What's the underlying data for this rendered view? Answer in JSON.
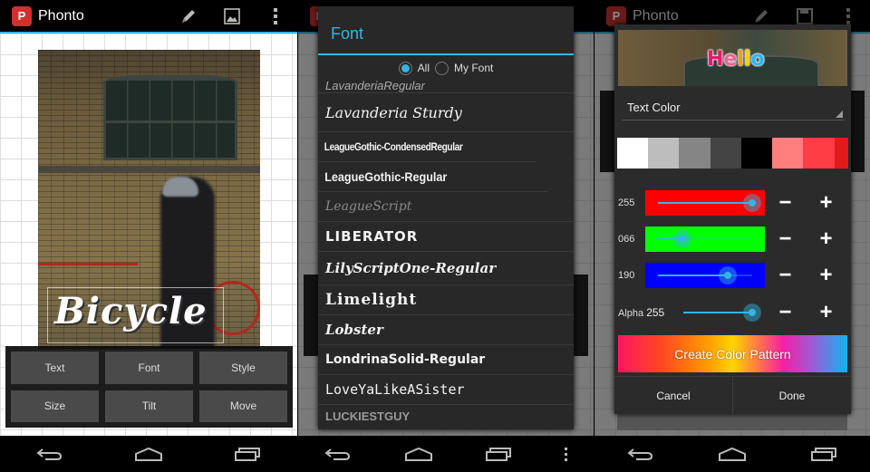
{
  "app": {
    "title": "Phonto",
    "logo_text": "P"
  },
  "screen1": {
    "actionbar_icons": [
      "pencil-icon",
      "image-icon",
      "overflow-menu-icon"
    ],
    "photo_text": "Bicycle",
    "tools": [
      {
        "label": "Text"
      },
      {
        "label": "Font"
      },
      {
        "label": "Style"
      },
      {
        "label": "Size"
      },
      {
        "label": "Tilt"
      },
      {
        "label": "Move"
      }
    ]
  },
  "screen2": {
    "dialog_title": "Font",
    "filter": {
      "options": [
        {
          "label": "All",
          "selected": true
        },
        {
          "label": "My Font",
          "selected": false
        }
      ]
    },
    "fonts": [
      "LavanderiaRegular",
      "Lavanderia Sturdy",
      "LeagueGothic-CondensedRegular",
      "LeagueGothic-Regular",
      "LeagueScript",
      "LIBERATOR",
      "LilyScriptOne-Regular",
      "Limelight",
      "Lobster",
      "LondrinaSolid-Regular",
      "LoveYaLikeASister",
      "LUCKIESTGUY"
    ]
  },
  "screen3": {
    "preview_text": "Hello",
    "mode_select": "Text Color",
    "swatches": [
      "#ffffff",
      "#bdbdbd",
      "#858585",
      "#444444",
      "#000000",
      "#ff7f7f",
      "#ff3d44",
      "#e01b1b"
    ],
    "channels": [
      {
        "name": "red",
        "label": "255",
        "value": 255,
        "max": 255,
        "color": "#ff0000"
      },
      {
        "name": "green",
        "label": "066",
        "value": 66,
        "max": 255,
        "color": "#00ff00"
      },
      {
        "name": "blue",
        "label": "190",
        "value": 190,
        "max": 255,
        "color": "#0000ff"
      }
    ],
    "alpha": {
      "label": "Alpha",
      "value_label": "255",
      "value": 255,
      "max": 255
    },
    "minus_label": "−",
    "plus_label": "+",
    "create_pattern_label": "Create Color Pattern",
    "cancel_label": "Cancel",
    "done_label": "Done"
  },
  "navbar": {
    "icons": [
      "back-icon",
      "home-icon",
      "recent-apps-icon"
    ]
  },
  "colors": {
    "accent": "#33b5e5",
    "logo": "#d32f2f"
  }
}
